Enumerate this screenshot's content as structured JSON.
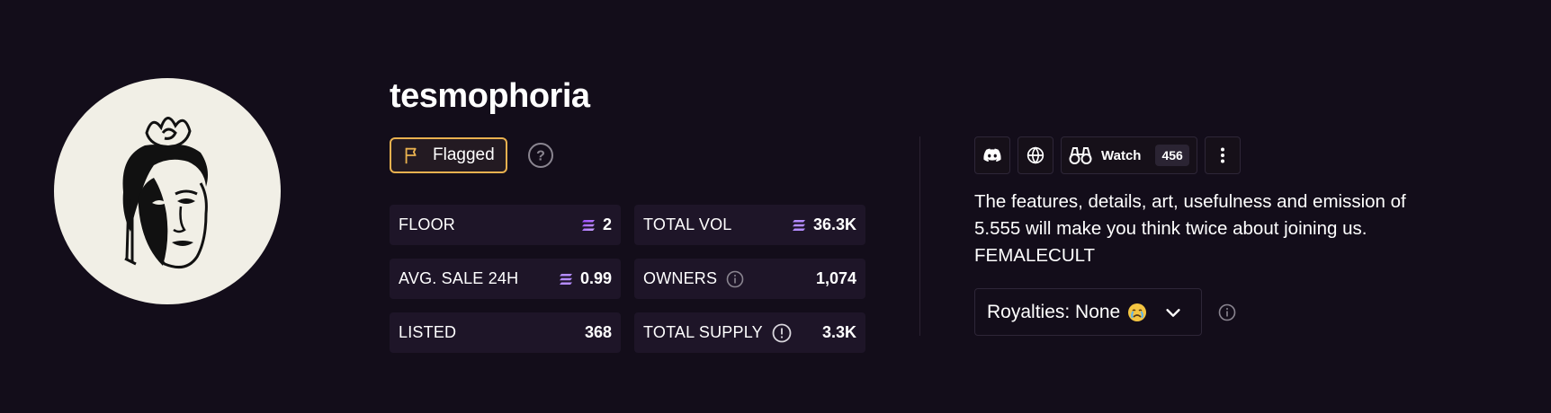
{
  "collection": {
    "name": "tesmophoria",
    "avatar_icon": "female-face-crown-icon"
  },
  "flag": {
    "label": "Flagged",
    "icon": "flag-icon",
    "border_color": "#e9b14f"
  },
  "help": {
    "icon": "question-circle-icon"
  },
  "stats": {
    "floor": {
      "label": "FLOOR",
      "value": "2",
      "currency_icon": "solana-icon"
    },
    "total_vol": {
      "label": "TOTAL VOL",
      "value": "36.3K",
      "currency_icon": "solana-icon"
    },
    "avg_sale": {
      "label": "AVG. SALE 24H",
      "value": "0.99",
      "currency_icon": "solana-icon"
    },
    "owners": {
      "label": "OWNERS",
      "value": "1,074",
      "info_icon": "info-icon"
    },
    "listed": {
      "label": "LISTED",
      "value": "368"
    },
    "total_supply": {
      "label": "TOTAL SUPPLY",
      "value": "3.3K",
      "info_icon": "alert-circle-icon"
    }
  },
  "actions": {
    "discord_icon": "discord-icon",
    "website_icon": "globe-icon",
    "watch": {
      "label": "Watch",
      "count": "456",
      "icon": "binoculars-icon"
    },
    "more_icon": "more-vertical-icon"
  },
  "description": "The features, details, art, usefulness and emission of 5.555 will make you think twice about joining us. FEMALECULT",
  "royalties": {
    "label": "Royalties: None",
    "emoji": "crying-face-emoji",
    "chevron": "chevron-down-icon"
  },
  "colors": {
    "background": "#130d1a",
    "stat_bg": "#1e1528",
    "accent_flag": "#e9b14f",
    "solana_gradient": [
      "#9945ff",
      "#14f195"
    ]
  }
}
